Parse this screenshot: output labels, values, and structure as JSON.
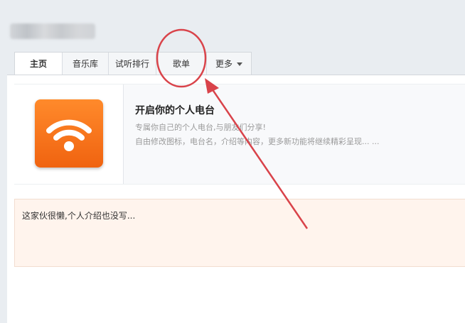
{
  "tabs": {
    "home": "主页",
    "music_library": "音乐库",
    "chart": "试听排行",
    "playlist": "歌单",
    "more": "更多"
  },
  "radio": {
    "title": "开启你的个人电台",
    "subtitle": "专属你自己的个人电台,与朋友们分享!",
    "description": "自由修改图标，电台名，介绍等内容，更多新功能将继续精彩呈现... ..."
  },
  "intro": {
    "text": "这家伙很懒,个人介绍也没写..."
  },
  "colors": {
    "annotation": "#d9434a",
    "icon_bg": "#f06a18"
  }
}
